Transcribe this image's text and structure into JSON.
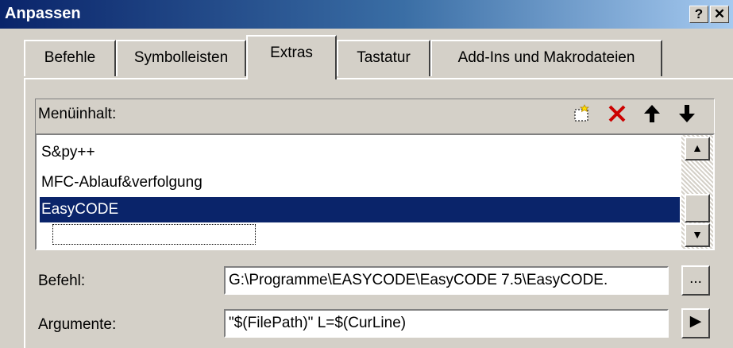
{
  "window": {
    "title": "Anpassen",
    "help_button": "?",
    "close_button": "✕"
  },
  "tabs": [
    {
      "label": "Befehle"
    },
    {
      "label": "Symbolleisten"
    },
    {
      "label": "Extras"
    },
    {
      "label": "Tastatur"
    },
    {
      "label": "Add-Ins und Makrodateien"
    }
  ],
  "active_tab": "Extras",
  "menu_contents": {
    "label": "Menüinhalt:",
    "toolbar_icons": [
      "new-item-icon",
      "delete-icon",
      "move-up-icon",
      "move-down-icon"
    ],
    "items": [
      {
        "label": "S&py++"
      },
      {
        "label": "MFC-Ablauf&verfolgung"
      },
      {
        "label": "EasyCODE",
        "selected": true
      },
      {
        "label": "",
        "placeholder": true
      }
    ]
  },
  "command": {
    "label": "Befehl:",
    "value": "G:\\Programme\\EASYCODE\\EasyCODE 7.5\\EasyCODE.",
    "browse_button": "..."
  },
  "arguments": {
    "label": "Argumente:",
    "value": "\"$(FilePath)\" L=$(CurLine)",
    "menu_button": "▶"
  },
  "colors": {
    "titlebar_start": "#0a246a",
    "titlebar_end": "#a6caf0",
    "selection": "#0a246a",
    "delete_icon": "#cc0000",
    "face": "#d4d0c8"
  }
}
